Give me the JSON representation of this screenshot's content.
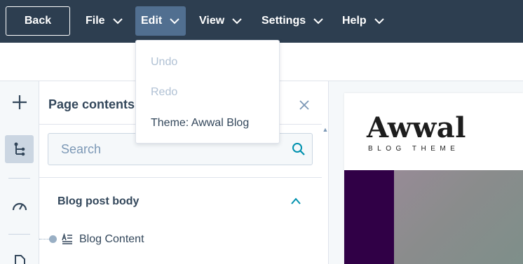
{
  "menubar": {
    "back_label": "Back",
    "items": [
      {
        "label": "File"
      },
      {
        "label": "Edit"
      },
      {
        "label": "View"
      },
      {
        "label": "Settings"
      },
      {
        "label": "Help"
      }
    ],
    "active": "Edit"
  },
  "edit_menu": {
    "items": [
      {
        "label": "Undo",
        "enabled": false
      },
      {
        "label": "Redo",
        "enabled": false
      },
      {
        "label": "Theme: Awwal Blog",
        "enabled": true
      }
    ]
  },
  "rail": {
    "icons": [
      "plus-icon",
      "tree-icon",
      "gauge-icon",
      "document-icon"
    ],
    "active": "tree-icon"
  },
  "panel": {
    "title": "Page contents",
    "search_placeholder": "Search",
    "section_title": "Blog post body",
    "items": [
      {
        "label": "Blog Content",
        "icon": "text-block-icon"
      }
    ]
  },
  "preview": {
    "brand_name": "Awwal",
    "brand_tagline": "BLOG THEME"
  },
  "colors": {
    "topbar": "#2d3e50",
    "active_menu": "#516f90",
    "text": "#33475b",
    "accent": "#0091ae",
    "hero_stripe": "#300046"
  }
}
